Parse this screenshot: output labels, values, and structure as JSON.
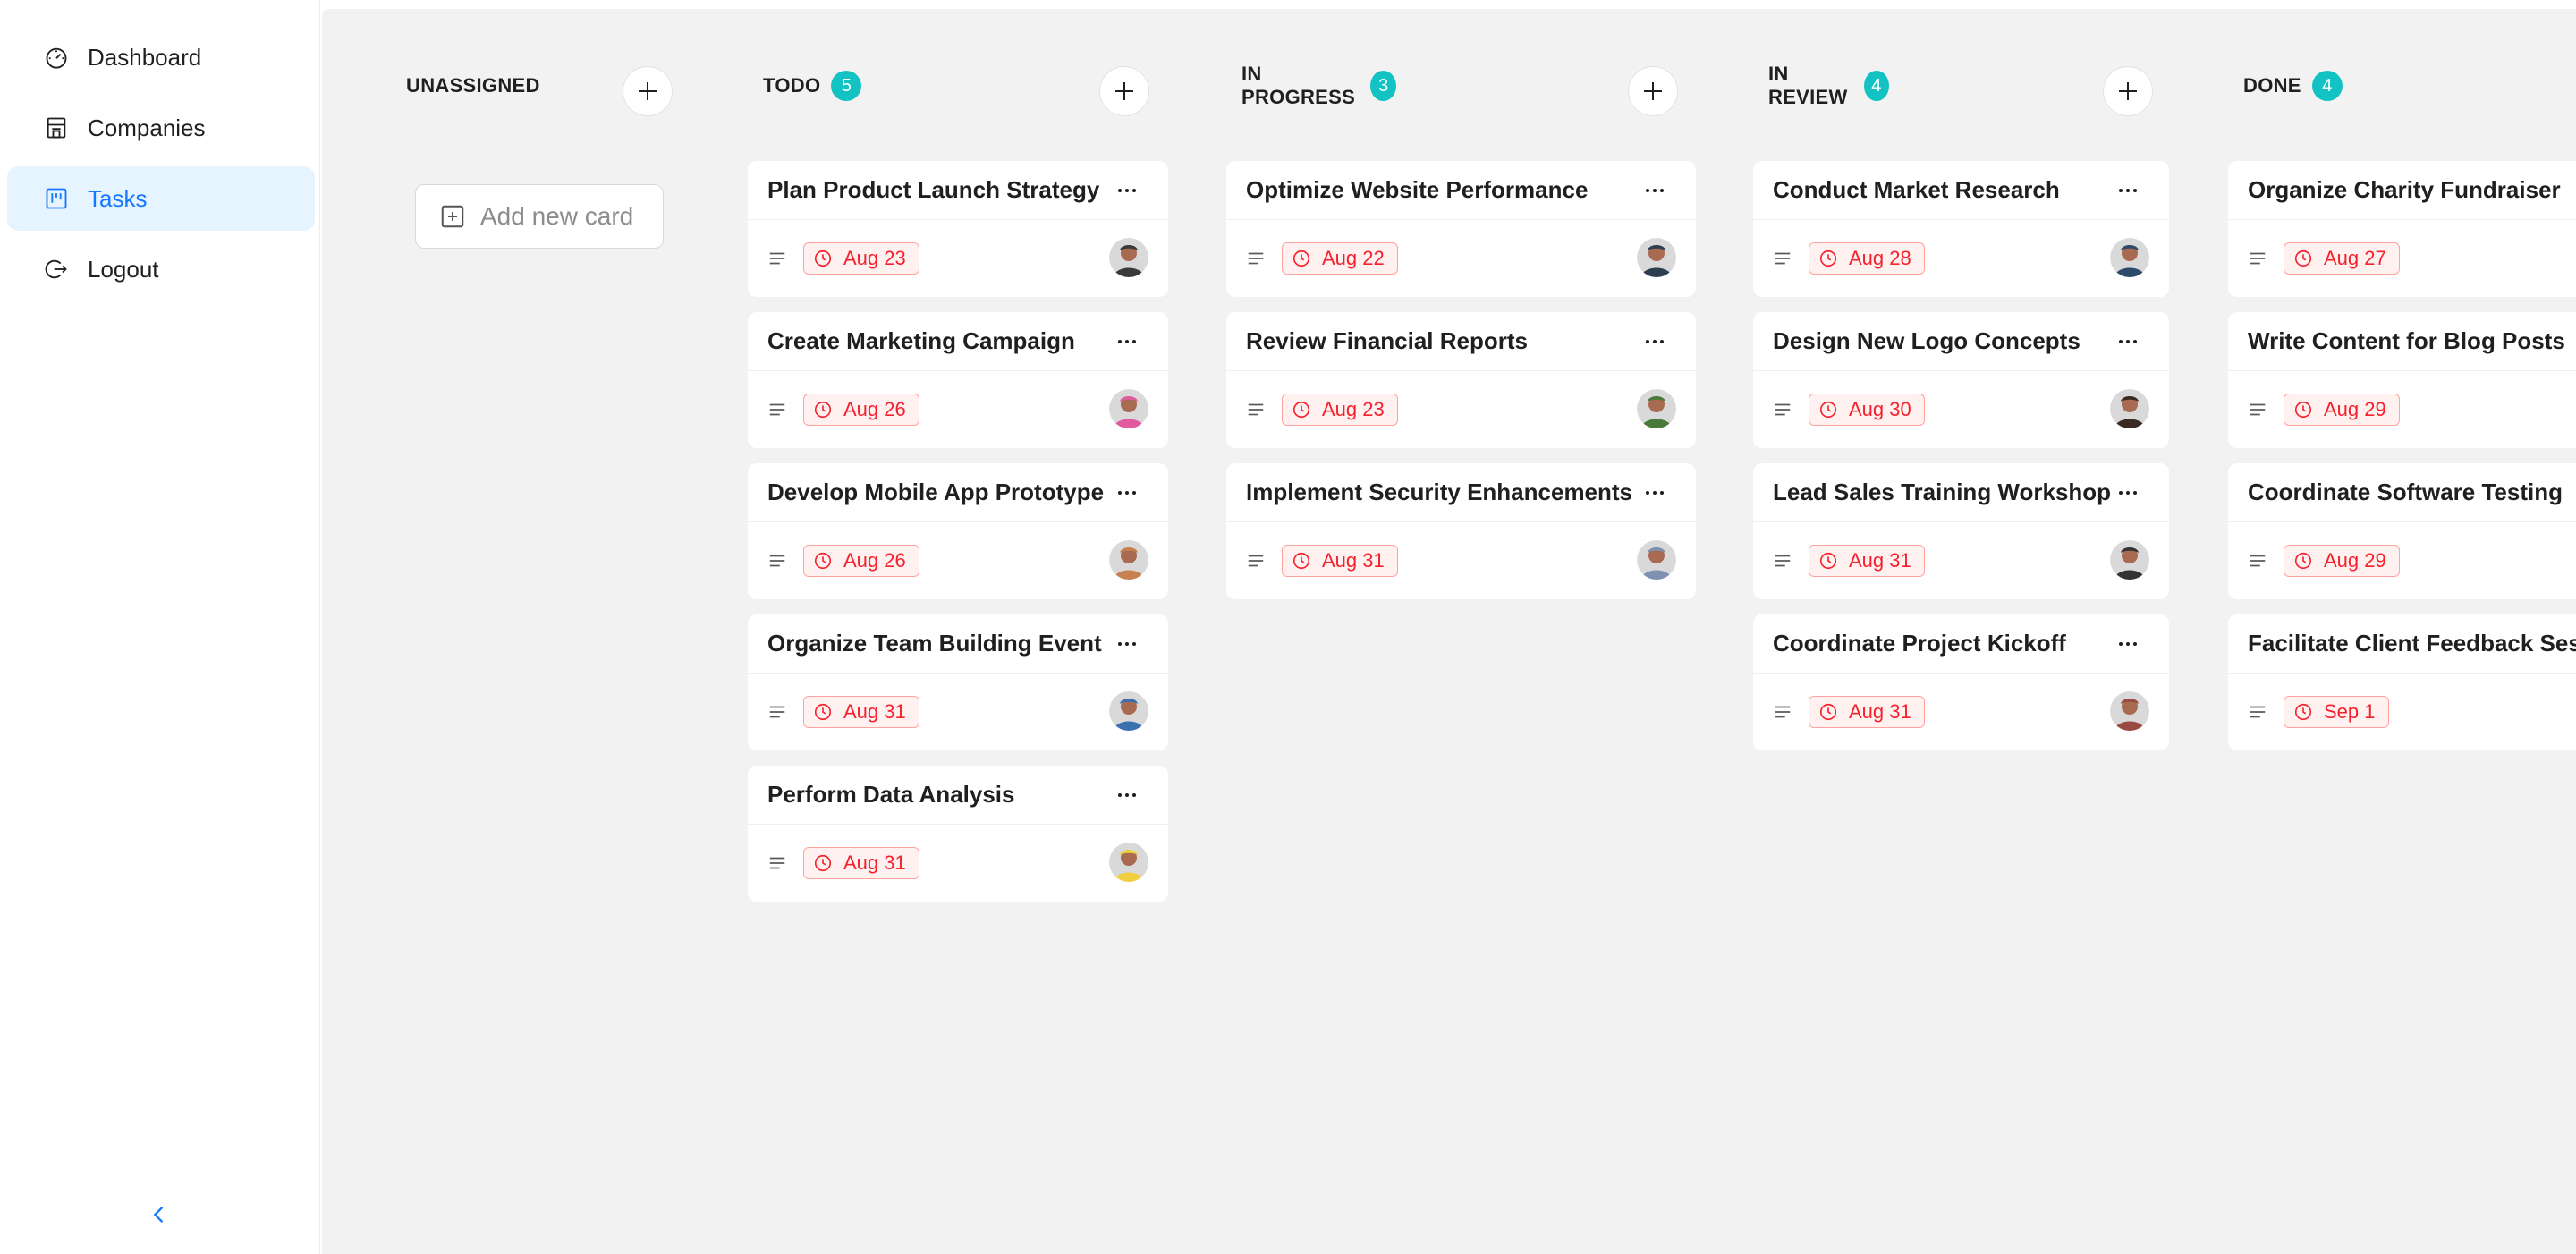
{
  "sidebar": {
    "items": [
      {
        "label": "Dashboard",
        "icon": "dashboard-icon"
      },
      {
        "label": "Companies",
        "icon": "shop-icon"
      },
      {
        "label": "Tasks",
        "icon": "project-icon",
        "active": true
      },
      {
        "label": "Logout",
        "icon": "logout-icon"
      }
    ],
    "collapse_icon": "chevron-left-icon"
  },
  "colors": {
    "accent": "#1677ff",
    "active_bg": "#e6f4ff",
    "badge": "#13c2c2",
    "board_bg": "#f2f2f2",
    "due_text": "#f5222d",
    "due_bg": "#fff1f0",
    "due_border": "#ffa39e"
  },
  "board": {
    "columns": [
      {
        "title": "UNASSIGNED",
        "count": "",
        "add_card_label": "Add new card",
        "cards": []
      },
      {
        "title": "TODO",
        "count": "5",
        "cards": [
          {
            "title": "Plan Product Launch Strategy",
            "due": "Aug 23"
          },
          {
            "title": "Create Marketing Campaign",
            "due": "Aug 26"
          },
          {
            "title": "Develop Mobile App Prototype",
            "due": "Aug 26"
          },
          {
            "title": "Organize Team Building Event",
            "due": "Aug 31"
          },
          {
            "title": "Perform Data Analysis",
            "due": "Aug 31"
          }
        ]
      },
      {
        "title": "IN PROGRESS",
        "count": "3",
        "cards": [
          {
            "title": "Optimize Website Performance",
            "due": "Aug 22"
          },
          {
            "title": "Review Financial Reports",
            "due": "Aug 23"
          },
          {
            "title": "Implement Security Enhancements",
            "due": "Aug 31"
          }
        ]
      },
      {
        "title": "IN REVIEW",
        "count": "4",
        "cards": [
          {
            "title": "Conduct Market Research",
            "due": "Aug 28"
          },
          {
            "title": "Design New Logo Concepts",
            "due": "Aug 30"
          },
          {
            "title": "Lead Sales Training Workshop",
            "due": "Aug 31"
          },
          {
            "title": "Coordinate Project Kickoff",
            "due": "Aug 31"
          }
        ]
      },
      {
        "title": "DONE",
        "count": "4",
        "cards": [
          {
            "title": "Organize Charity Fundraiser",
            "due": "Aug 27"
          },
          {
            "title": "Write Content for Blog Posts",
            "due": "Aug 29"
          },
          {
            "title": "Coordinate Software Testing",
            "due": "Aug 29"
          },
          {
            "title": "Facilitate Client Feedback Session",
            "due": "Sep 1"
          }
        ]
      }
    ]
  }
}
